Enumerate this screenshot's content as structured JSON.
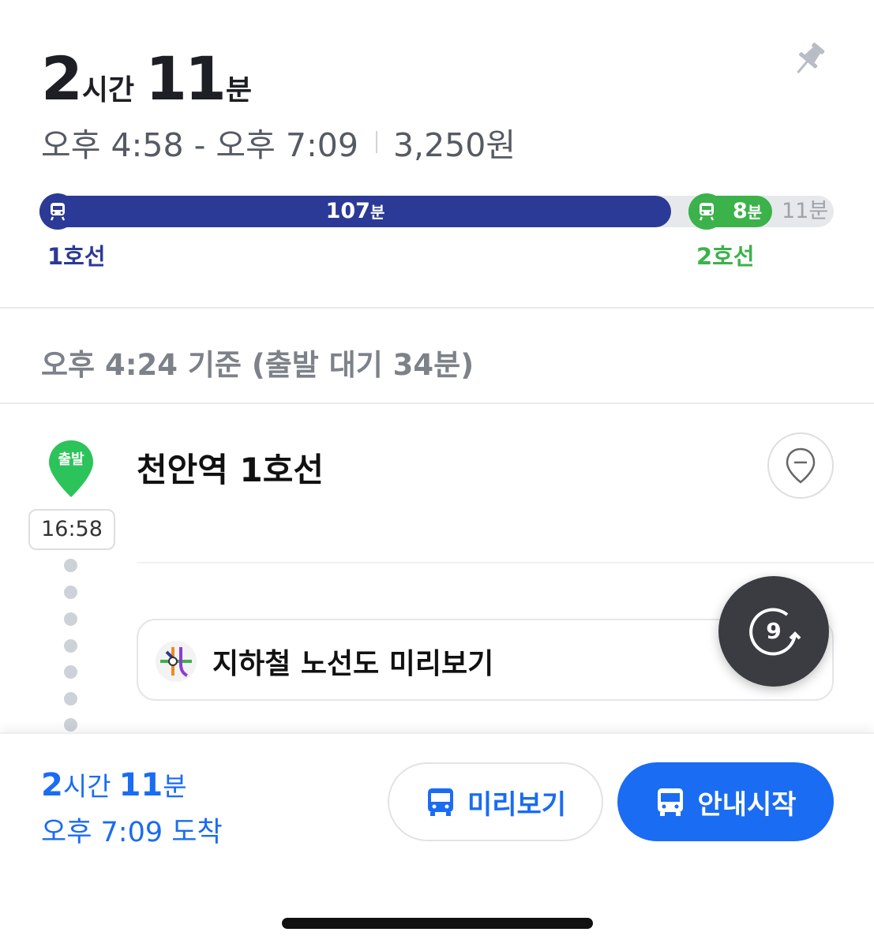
{
  "summary": {
    "hours": "2",
    "hours_unit": "시간",
    "minutes": "11",
    "minutes_unit": "분",
    "time_range": "오후 4:58 - 오후 7:09",
    "fare": "3,250원"
  },
  "timeline": {
    "segment1_duration": "107",
    "segment1_unit": "분",
    "segment1_line": "1호선",
    "segment1_color": "#2b3a96",
    "segment2_duration": "8",
    "segment2_unit": "분",
    "segment2_line": "2호선",
    "segment2_color": "#3bb24a",
    "walk_duration": "11분"
  },
  "basis_text": "오후 4:24 기준 (출발 대기 34분)",
  "route": {
    "origin_badge": "출발",
    "depart_time": "16:58",
    "station_name": "천안역 1호선",
    "map_preview_label": "지하철 노선도 미리보기",
    "refresh_count": "9"
  },
  "bottom": {
    "hours": "2",
    "hours_unit": "시간",
    "minutes": "11",
    "minutes_unit": "분",
    "arrival_text": "오후 7:09 도착",
    "preview_label": "미리보기",
    "start_label": "안내시작",
    "accent_color": "#1a6cf2"
  },
  "icons": [
    "pin-icon",
    "train-icon",
    "location-pin-icon",
    "subway-map-icon",
    "refresh-icon",
    "bus-icon"
  ]
}
